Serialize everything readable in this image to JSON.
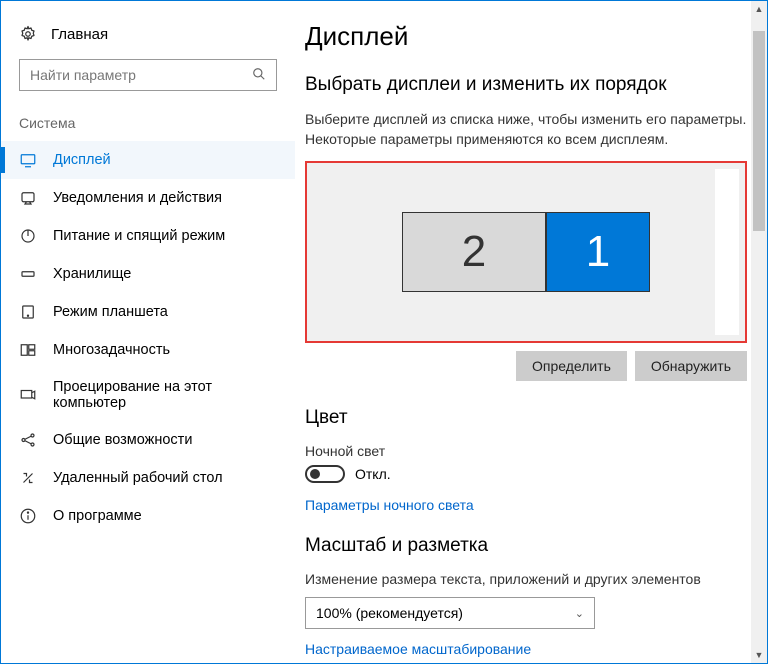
{
  "sidebar": {
    "home_label": "Главная",
    "search_placeholder": "Найти параметр",
    "section_label": "Система",
    "items": [
      {
        "label": "Дисплей"
      },
      {
        "label": "Уведомления и действия"
      },
      {
        "label": "Питание и спящий режим"
      },
      {
        "label": "Хранилище"
      },
      {
        "label": "Режим планшета"
      },
      {
        "label": "Многозадачность"
      },
      {
        "label": "Проецирование на этот компьютер"
      },
      {
        "label": "Общие возможности"
      },
      {
        "label": "Удаленный рабочий стол"
      },
      {
        "label": "О программе"
      }
    ]
  },
  "main": {
    "title": "Дисплей",
    "arrange_header": "Выбрать дисплеи и изменить их порядок",
    "arrange_desc": "Выберите дисплей из списка ниже, чтобы изменить его параметры. Некоторые параметры применяются ко всем дисплеям.",
    "monitor2": "2",
    "monitor1": "1",
    "identify_label": "Определить",
    "detect_label": "Обнаружить",
    "color_header": "Цвет",
    "night_light_label": "Ночной свет",
    "toggle_state": "Откл.",
    "night_light_link": "Параметры ночного света",
    "scale_header": "Масштаб и разметка",
    "scale_desc": "Изменение размера текста, приложений и других элементов",
    "scale_value": "100% (рекомендуется)",
    "custom_scale_link": "Настраиваемое масштабирование"
  }
}
